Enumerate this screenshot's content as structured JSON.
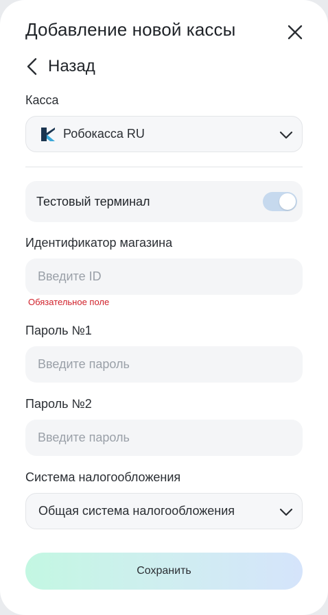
{
  "header": {
    "title": "Добавление новой кассы",
    "back_label": "Назад"
  },
  "cashbox": {
    "label": "Касса",
    "selected": "Робокасса RU",
    "logo_icon": "robokassa-logo"
  },
  "test_terminal": {
    "label": "Тестовый терминал",
    "enabled": true
  },
  "shop_id": {
    "label": "Идентификатор магазина",
    "placeholder": "Введите ID",
    "value": "",
    "error": "Обязательное поле"
  },
  "password1": {
    "label": "Пароль №1",
    "placeholder": "Введите пароль",
    "value": ""
  },
  "password2": {
    "label": "Пароль №2",
    "placeholder": "Введите пароль",
    "value": ""
  },
  "tax_system": {
    "label": "Система налогообложения",
    "selected": "Общая система налогообложения"
  },
  "actions": {
    "save_label": "Сохранить"
  },
  "colors": {
    "accent_toggle": "#c6d9ee",
    "error": "#d0202a",
    "field_bg": "#f4f5f7",
    "save_gradient_start": "#c3f7e2",
    "save_gradient_end": "#d5e4fb"
  }
}
